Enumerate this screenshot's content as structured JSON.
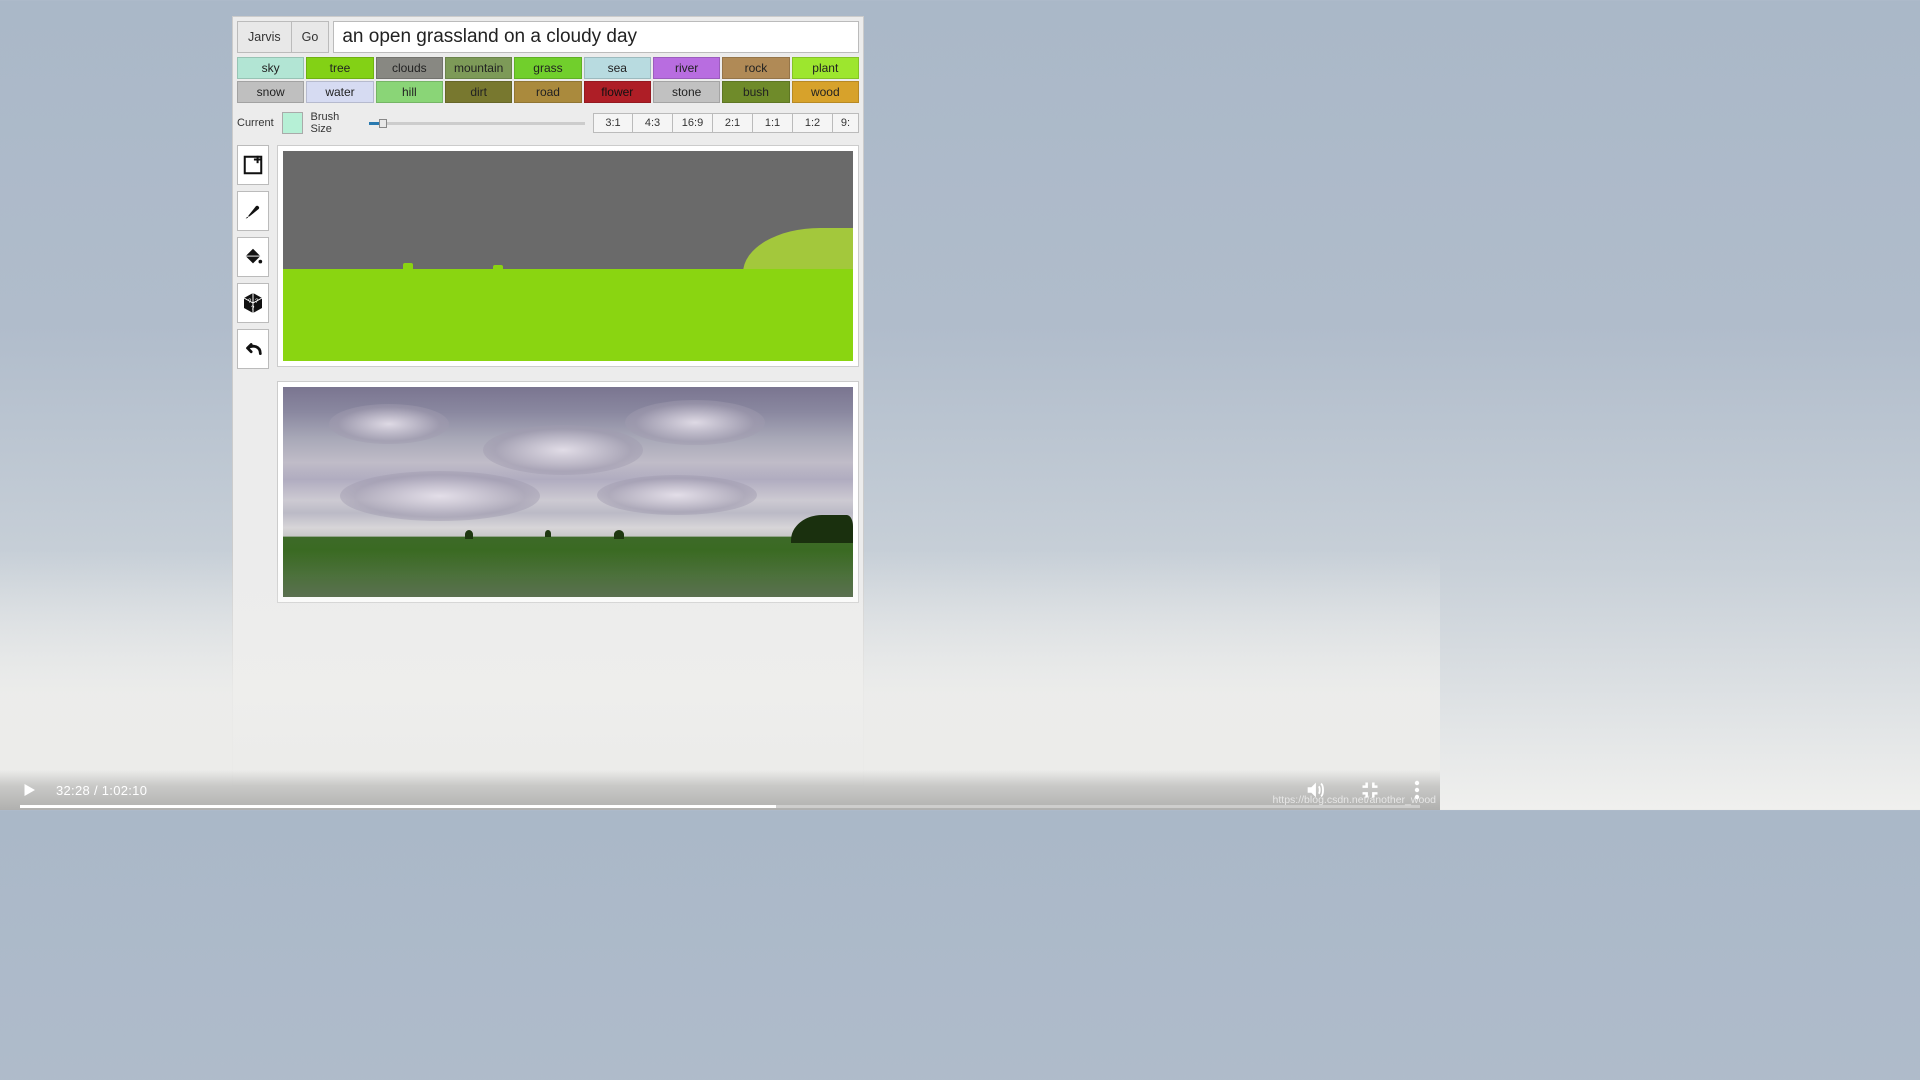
{
  "header": {
    "jarvis_label": "Jarvis",
    "go_label": "Go",
    "prompt_value": "an open grassland on a cloudy day"
  },
  "palette": {
    "row1": [
      {
        "label": "sky",
        "color": "#b2e5d4"
      },
      {
        "label": "tree",
        "color": "#83d115"
      },
      {
        "label": "clouds",
        "color": "#888882"
      },
      {
        "label": "mountain",
        "color": "#7d9a58"
      },
      {
        "label": "grass",
        "color": "#71cf2c"
      },
      {
        "label": "sea",
        "color": "#b8dbe0"
      },
      {
        "label": "river",
        "color": "#b86de0"
      },
      {
        "label": "rock",
        "color": "#b08a56"
      },
      {
        "label": "plant",
        "color": "#9de62e"
      }
    ],
    "row2": [
      {
        "label": "snow",
        "color": "#bfbfbf"
      },
      {
        "label": "water",
        "color": "#d6dbf2"
      },
      {
        "label": "hill",
        "color": "#8ad577"
      },
      {
        "label": "dirt",
        "color": "#78782f"
      },
      {
        "label": "road",
        "color": "#aa8a3d"
      },
      {
        "label": "flower",
        "color": "#ae1e26"
      },
      {
        "label": "stone",
        "color": "#c1c1c1"
      },
      {
        "label": "bush",
        "color": "#6f8b2a"
      },
      {
        "label": "wood",
        "color": "#d7a22b"
      }
    ]
  },
  "controls": {
    "current_label": "Current",
    "current_color": "#b6f0d6",
    "brush_label": "Brush Size",
    "brush_value_pct": 5,
    "ratios": [
      "3:1",
      "4:3",
      "16:9",
      "2:1",
      "1:1",
      "1:2",
      "9:"
    ]
  },
  "tools": {
    "new_canvas": "new-canvas",
    "brush": "brush",
    "fill": "fill",
    "dice": "random",
    "undo": "undo"
  },
  "canvases": {
    "segmentation": {
      "sky_color": "#6a6a6a",
      "grass_color": "#8ad511",
      "hill_color": "#a3c83c"
    },
    "output_desc": "generated photo of open grassland on cloudy day"
  },
  "player": {
    "current_time": "32:28",
    "duration": "1:02:10",
    "time_display": "32:28 / 1:02:10",
    "progress_pct": 54
  },
  "watermark": "https://blog.csdn.net/another_wood"
}
